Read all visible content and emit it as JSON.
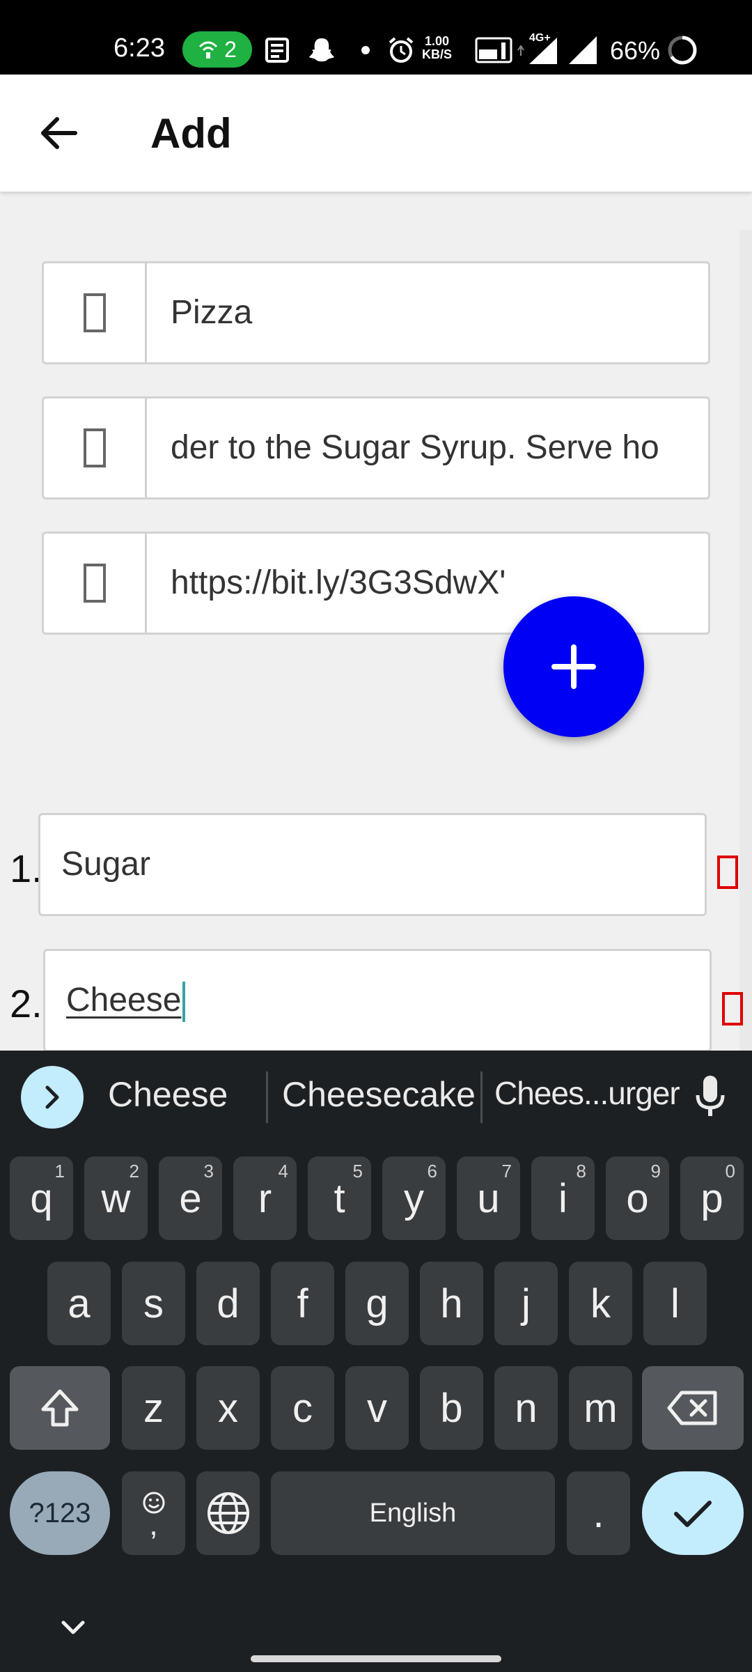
{
  "status_bar": {
    "time": "6:23",
    "hotspot_count": "2",
    "net_speed_value": "1.00",
    "net_speed_unit": "KB/S",
    "network_label": "4G+",
    "battery": "66%"
  },
  "app_bar": {
    "title": "Add",
    "back_icon": "arrow-left-icon"
  },
  "form": {
    "name_value": "Pizza",
    "instructions_value": "der to the Sugar Syrup. Serve ho",
    "link_value": "https://bit.ly/3G3SdwX'",
    "field_icon": "missing-glyph-icon"
  },
  "fab": {
    "icon": "plus-icon",
    "color": "#0000f5"
  },
  "ingredients": [
    {
      "number": "1.",
      "value": "Sugar"
    },
    {
      "number": "2.",
      "value": "Cheese"
    }
  ],
  "keyboard": {
    "suggestions": [
      "Cheese",
      "Cheesecake",
      "Chees...urger"
    ],
    "row1": [
      {
        "key": "q",
        "hint": "1"
      },
      {
        "key": "w",
        "hint": "2"
      },
      {
        "key": "e",
        "hint": "3"
      },
      {
        "key": "r",
        "hint": "4"
      },
      {
        "key": "t",
        "hint": "5"
      },
      {
        "key": "y",
        "hint": "6"
      },
      {
        "key": "u",
        "hint": "7"
      },
      {
        "key": "i",
        "hint": "8"
      },
      {
        "key": "o",
        "hint": "9"
      },
      {
        "key": "p",
        "hint": "0"
      }
    ],
    "row2": [
      "a",
      "s",
      "d",
      "f",
      "g",
      "h",
      "j",
      "k",
      "l"
    ],
    "row3": [
      "z",
      "x",
      "c",
      "v",
      "b",
      "n",
      "m"
    ],
    "symbols_label": "?123",
    "comma": ",",
    "space_label": "English",
    "period": "."
  },
  "colors": {
    "accent": "#0000f5",
    "delete_red": "#e00000",
    "keyboard_bg": "#1d2023",
    "enter_key": "#c3ecfd"
  }
}
